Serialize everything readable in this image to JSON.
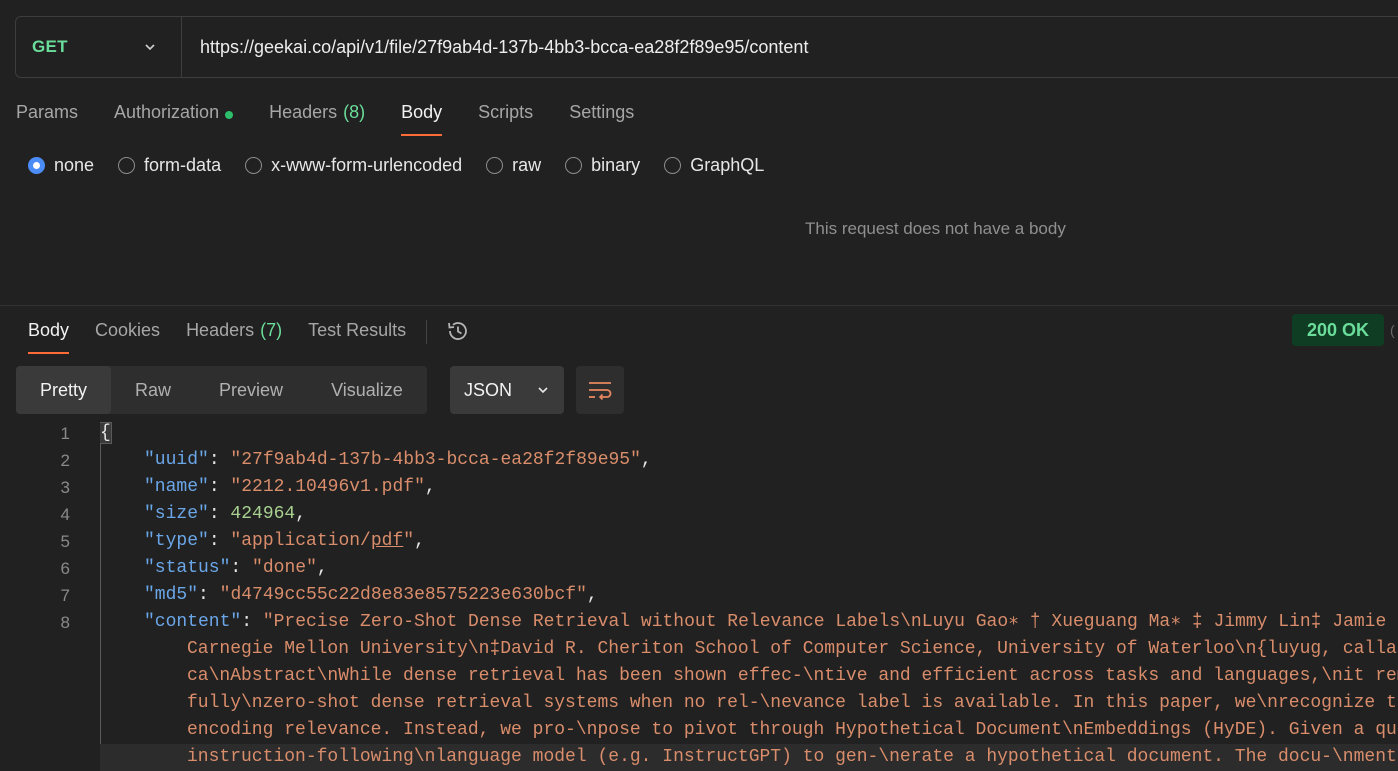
{
  "request": {
    "method": "GET",
    "url": "https://geekai.co/api/v1/file/27f9ab4d-137b-4bb3-bcca-ea28f2f89e95/content",
    "tabs": [
      {
        "label": "Params"
      },
      {
        "label": "Authorization"
      },
      {
        "label": "Headers",
        "count": "(8)"
      },
      {
        "label": "Body"
      },
      {
        "label": "Scripts"
      },
      {
        "label": "Settings"
      }
    ],
    "body_types": [
      "none",
      "form-data",
      "x-www-form-urlencoded",
      "raw",
      "binary",
      "GraphQL"
    ],
    "selected_body_type": "none",
    "empty_message": "This request does not have a body"
  },
  "response": {
    "tabs": [
      {
        "label": "Body"
      },
      {
        "label": "Cookies"
      },
      {
        "label": "Headers",
        "count": "(7)"
      },
      {
        "label": "Test Results"
      }
    ],
    "status": "200 OK",
    "views": [
      "Pretty",
      "Raw",
      "Preview",
      "Visualize"
    ],
    "format": "JSON",
    "line_numbers": [
      "1",
      "2",
      "3",
      "4",
      "5",
      "6",
      "7",
      "8"
    ],
    "json": {
      "uuid": "27f9ab4d-137b-4bb3-bcca-ea28f2f89e95",
      "name": "2212.10496v1.pdf",
      "size": "424964",
      "type_a": "application/",
      "type_b": "pdf",
      "status": "done",
      "md5": "d4749cc55c22d8e83e8575223e630bcf",
      "content_lines": [
        "\"Precise Zero-Shot Dense Retrieval without Relevance Labels\\nLuyu Gao∗ † Xueguang Ma∗ ‡ Jimmy Lin‡ Jamie C",
        "Carnegie Mellon University\\n‡David R. Cheriton School of Computer Science, University of Waterloo\\n{luyug, calla",
        "ca\\nAbstract\\nWhile dense retrieval has been shown effec-\\ntive and efficient across tasks and languages,\\nit rem",
        "fully\\nzero-shot dense retrieval systems when no rel-\\nevance label is available. In this paper, we\\nrecognize t",
        "encoding relevance. Instead, we pro-\\npose to pivot through Hypothetical Document\\nEmbeddings (HyDE). Given a que",
        "instruction-following\\nlanguage model (e.g. InstructGPT) to gen-\\nerate a hypothetical document. The docu-\\nment"
      ]
    }
  },
  "colors": {
    "accent": "#ff6c37",
    "method": "#6bdd9a",
    "status_bg": "#0f3d24",
    "json_key": "#6aa6e8",
    "json_string": "#d98d6b",
    "json_number": "#a8d191"
  }
}
